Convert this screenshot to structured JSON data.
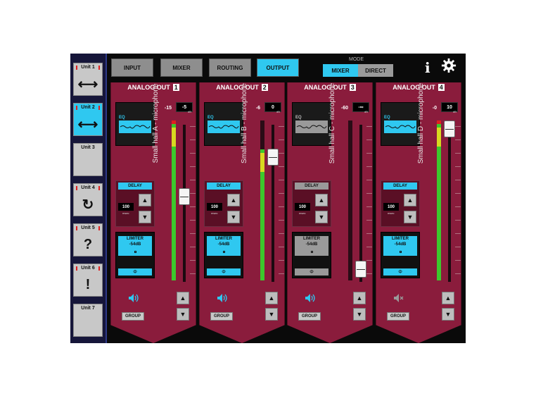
{
  "sidebar": {
    "units": [
      {
        "label": "Unit 1",
        "icon": "arrows-horizontal-icon",
        "glyph": "⟷",
        "leds": true,
        "active": false
      },
      {
        "label": "Unit 2",
        "icon": "arrows-horizontal-icon",
        "glyph": "⟷",
        "leds": true,
        "active": true
      },
      {
        "label": "Unit 3",
        "icon": "",
        "glyph": "",
        "leds": false,
        "active": false
      },
      {
        "label": "Unit 4",
        "icon": "refresh-icon",
        "glyph": "↻",
        "leds": true,
        "active": false
      },
      {
        "label": "Unit 5",
        "icon": "question-icon",
        "glyph": "?",
        "leds": true,
        "active": false
      },
      {
        "label": "Unit 6",
        "icon": "exclamation-icon",
        "glyph": "!",
        "leds": true,
        "active": false
      },
      {
        "label": "Unit 7",
        "icon": "",
        "glyph": "",
        "leds": false,
        "active": false
      }
    ]
  },
  "topbar": {
    "tabs": [
      {
        "label": "INPUT",
        "active": false
      },
      {
        "label": "MIXER",
        "active": false
      },
      {
        "label": "ROUTING",
        "active": false
      },
      {
        "label": "OUTPUT",
        "active": true
      }
    ],
    "mode_label": "MODE",
    "mode_buttons": [
      {
        "label": "MIXER",
        "active": true
      },
      {
        "label": "DIRECT",
        "active": false
      }
    ],
    "info_icon": "info-icon",
    "settings_icon": "gear-icon"
  },
  "colors": {
    "accent": "#2fc8f0",
    "channel_bg": "#8a1c3c",
    "inactive_button": "#9a9a9a",
    "meter_green": "#3cc82c",
    "meter_yellow": "#d8d820",
    "meter_red": "#e02020"
  },
  "channels": [
    {
      "title": "ANALOG OUT",
      "number": "1",
      "name": "Small hall A - microphone",
      "eq_label": "EQ",
      "eq_active": true,
      "delay_label": "DELAY",
      "delay_active": true,
      "delay_value": "100",
      "delay_unit": "msec",
      "limiter_line1": "LIMITER",
      "limiter_line2": "-54dB",
      "limiter_active": true,
      "phase_symbol": "Φ",
      "gain_db": "-15",
      "gain_value": "-5",
      "gain_unit": "dB",
      "fader_level": 0.52,
      "meter_level": 0.98,
      "muted": false,
      "group_label": "GROUP",
      "up_symbol": "▲",
      "down_symbol": "▼"
    },
    {
      "title": "ANALOG OUT",
      "number": "2",
      "name": "Small hall B - microphone",
      "eq_label": "EQ",
      "eq_active": true,
      "delay_label": "DELAY",
      "delay_active": true,
      "delay_value": "100",
      "delay_unit": "msec",
      "limiter_line1": "LIMITER",
      "limiter_line2": "-54dB",
      "limiter_active": true,
      "phase_symbol": "Φ",
      "gain_db": "-6",
      "gain_value": "0",
      "gain_unit": "dB",
      "fader_level": 0.8,
      "meter_level": 0.82,
      "muted": false,
      "group_label": "GROUP",
      "up_symbol": "▲",
      "down_symbol": "▼"
    },
    {
      "title": "ANALOG OUT",
      "number": "3",
      "name": "Small hall C - microphone",
      "eq_label": "EQ",
      "eq_active": false,
      "delay_label": "DELAY",
      "delay_active": false,
      "delay_value": "100",
      "delay_unit": "msec",
      "limiter_line1": "LIMITER",
      "limiter_line2": "-54dB",
      "limiter_active": false,
      "phase_symbol": "Φ",
      "gain_db": "-60",
      "gain_value": "-∞",
      "gain_unit": "dB",
      "fader_level": 0.0,
      "meter_level": 0.0,
      "muted": false,
      "group_label": "GROUP",
      "up_symbol": "▲",
      "down_symbol": "▼"
    },
    {
      "title": "ANALOG OUT",
      "number": "4",
      "name": "Small hall D - microphone",
      "eq_label": "EQ",
      "eq_active": true,
      "delay_label": "DELAY",
      "delay_active": true,
      "delay_value": "100",
      "delay_unit": "msec",
      "limiter_line1": "LIMITER",
      "limiter_line2": "-54dB",
      "limiter_active": true,
      "phase_symbol": "Φ",
      "gain_db": "-0",
      "gain_value": "10",
      "gain_unit": "dB",
      "fader_level": 1.0,
      "meter_level": 0.98,
      "muted": true,
      "group_label": "GROUP",
      "up_symbol": "▲",
      "down_symbol": "▼"
    }
  ]
}
